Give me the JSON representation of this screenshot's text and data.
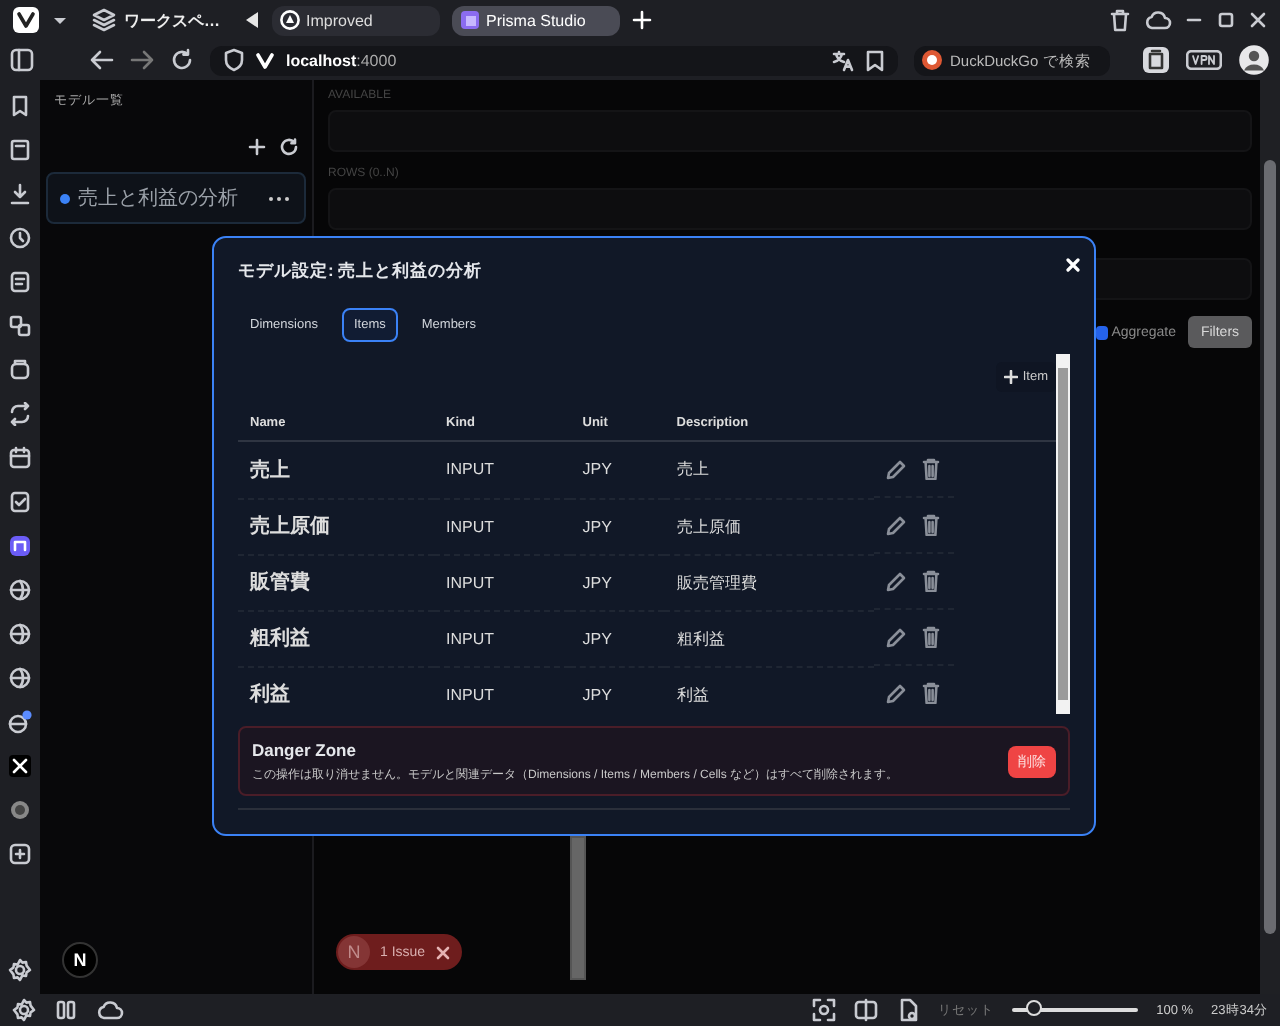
{
  "browser": {
    "workspace": "ワークスペ…",
    "tabs": [
      {
        "label": "Improved",
        "selected": false
      },
      {
        "label": "Prisma Studio",
        "selected": true
      }
    ],
    "url_host": "localhost",
    "url_port": ":4000",
    "search": {
      "placeholder": "DuckDuckGo で検索"
    }
  },
  "model_panel": {
    "title": "モデル一覧",
    "models": [
      {
        "name": "売上と利益の分析",
        "selected": true
      }
    ]
  },
  "main": {
    "fields": [
      {
        "label": "AVAILABLE"
      },
      {
        "label": "ROWS (0..N)"
      }
    ],
    "aggregate": {
      "label": "Aggregate",
      "checked": true
    },
    "filters_button": {
      "label": "Filters",
      "disabled": true
    }
  },
  "modal": {
    "title": "モデル設定: 売上と利益の分析",
    "tabs": [
      {
        "label": "Dimensions",
        "selected": false
      },
      {
        "label": "Items",
        "selected": true
      },
      {
        "label": "Members",
        "selected": false
      }
    ],
    "add_button": "Item",
    "columns": [
      "Name",
      "Kind",
      "Unit",
      "Description"
    ],
    "rows": [
      [
        "売上",
        "INPUT",
        "JPY",
        "売上"
      ],
      [
        "売上原価",
        "INPUT",
        "JPY",
        "売上原価"
      ],
      [
        "販管費",
        "INPUT",
        "JPY",
        "販売管理費"
      ],
      [
        "粗利益",
        "INPUT",
        "JPY",
        "粗利益"
      ],
      [
        "利益",
        "INPUT",
        "JPY",
        "利益"
      ]
    ],
    "danger_zone": {
      "title": "Danger Zone",
      "text": "この操作は取り消せません。モデルと関連データ（Dimensions / Items / Members / Cells など）はすべて削除されます。",
      "button": "削除"
    }
  },
  "issue_badge": {
    "logo": "N",
    "label": "1 Issue"
  },
  "dev_logo": "N",
  "status_bar": {
    "reset": "リセット",
    "zoom": {
      "level": 0.18
    },
    "zoom_text": "100 %",
    "clock": "23時34分"
  }
}
